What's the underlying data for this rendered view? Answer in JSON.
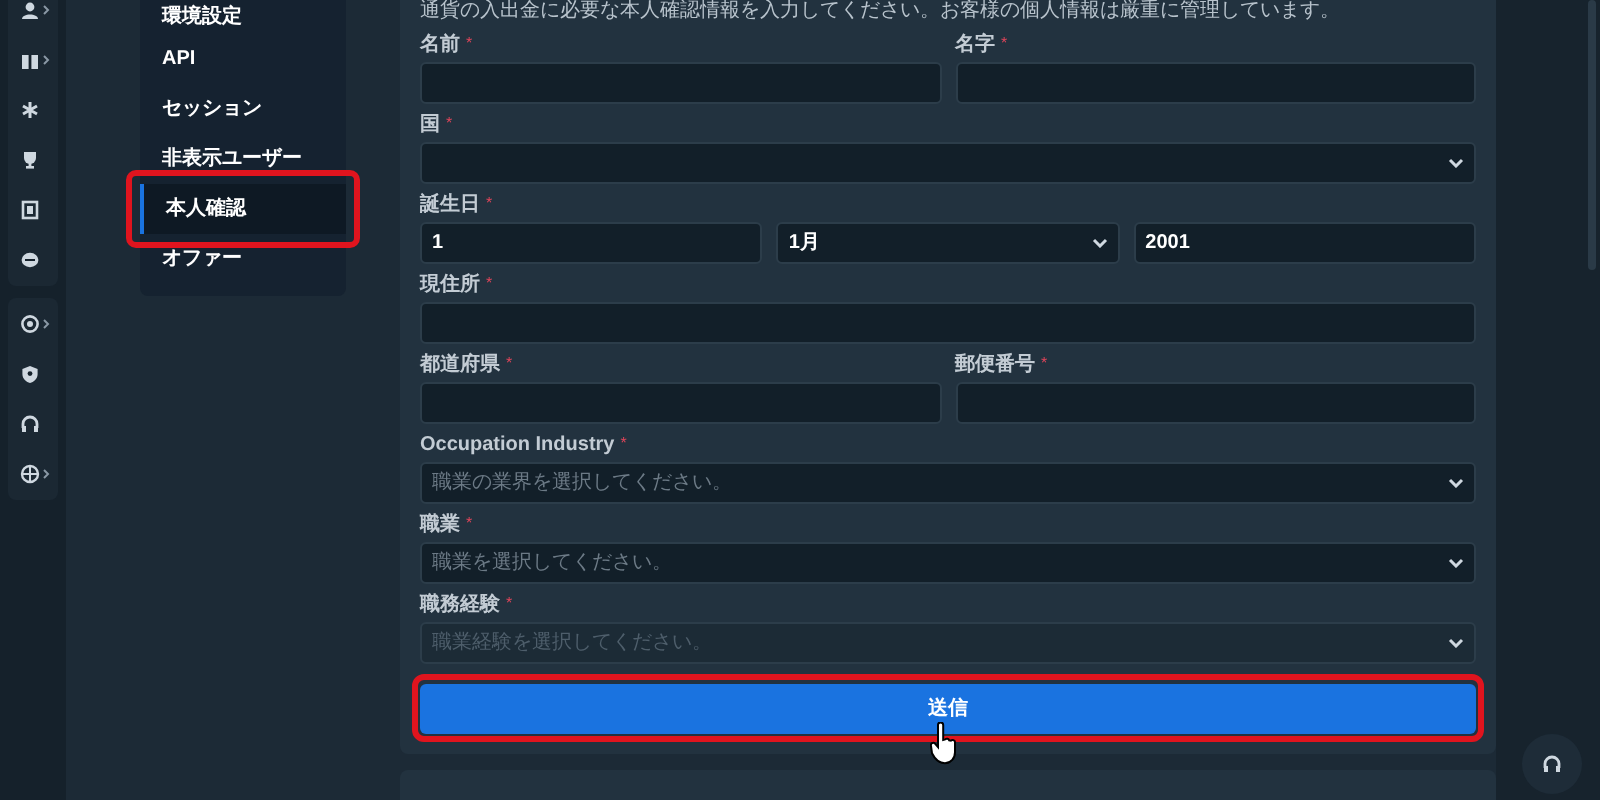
{
  "rail": {
    "groups": [
      [
        {
          "expandable": true
        },
        {
          "expandable": true
        },
        {
          "expandable": false
        },
        {
          "expandable": false
        },
        {
          "expandable": false
        },
        {
          "expandable": false
        }
      ],
      [
        {
          "expandable": true
        },
        {
          "expandable": false
        },
        {
          "expandable": false
        },
        {
          "expandable": true
        }
      ]
    ]
  },
  "menu": {
    "items": [
      {
        "label": "環境設定",
        "selected": false,
        "highlighted": false
      },
      {
        "label": "API",
        "selected": false,
        "highlighted": false
      },
      {
        "label": "セッション",
        "selected": false,
        "highlighted": false
      },
      {
        "label": "非表示ユーザー",
        "selected": false,
        "highlighted": false
      },
      {
        "label": "本人確認",
        "selected": true,
        "highlighted": true
      },
      {
        "label": "オファー",
        "selected": false,
        "highlighted": false
      }
    ]
  },
  "form": {
    "description": "通貨の入出金に必要な本人確認情報を入力してください。お客様の個人情報は厳重に管理しています。",
    "rows": [
      [
        {
          "kind": "input",
          "label": "名前",
          "required_mark": "*",
          "disabled": false
        },
        {
          "kind": "input",
          "label": "名字",
          "required_mark": "*",
          "disabled": false
        }
      ],
      [
        {
          "kind": "select",
          "label": "国",
          "required_mark": "*",
          "disabled": false
        }
      ],
      [
        {
          "kind": "input",
          "label": "誕生日",
          "required_mark": "*",
          "value": "1",
          "disabled": false
        },
        {
          "kind": "select",
          "value": "1月",
          "disabled": false
        },
        {
          "kind": "input",
          "value": "2001",
          "disabled": false
        }
      ],
      [
        {
          "kind": "input",
          "label": "現住所",
          "required_mark": "*",
          "disabled": false
        }
      ],
      [
        {
          "kind": "input",
          "label": "都道府県",
          "required_mark": "*",
          "disabled": false
        },
        {
          "kind": "input",
          "label": "郵便番号",
          "required_mark": "*",
          "disabled": false
        }
      ],
      [
        {
          "kind": "select",
          "label": "Occupation Industry",
          "required_mark": "*",
          "placeholder": "職業の業界を選択してください。",
          "disabled": false
        }
      ],
      [
        {
          "kind": "select",
          "label": "職業",
          "required_mark": "*",
          "placeholder": "職業を選択してください。",
          "disabled": false
        }
      ],
      [
        {
          "kind": "select",
          "label": "職務経験",
          "required_mark": "*",
          "placeholder": "職業経験を選択してください。",
          "disabled": true
        }
      ]
    ],
    "submit": {
      "label": "送信",
      "highlighted": true
    }
  }
}
